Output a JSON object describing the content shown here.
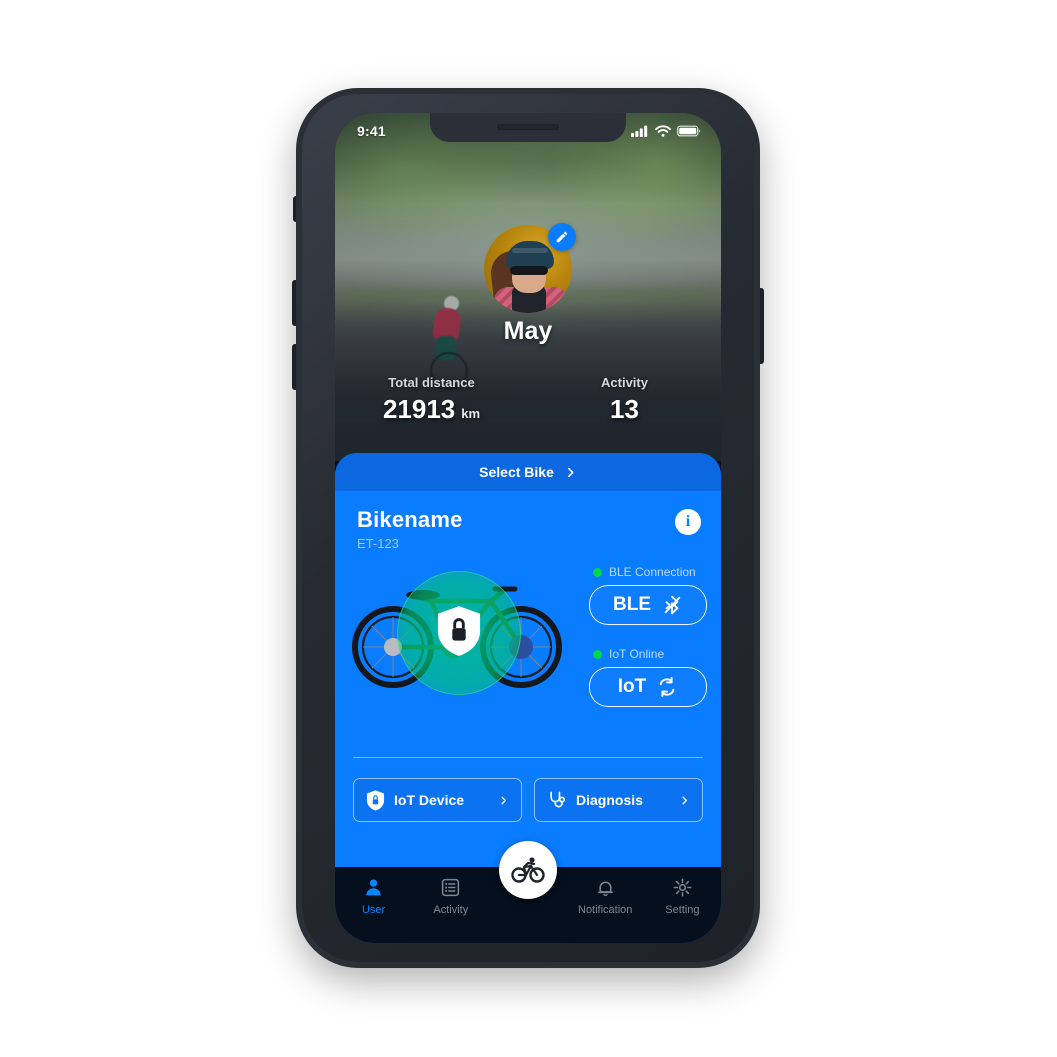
{
  "status_bar": {
    "time": "9:41",
    "icons": [
      "cellular-signal-icon",
      "wifi-icon",
      "battery-icon"
    ]
  },
  "hero": {
    "avatar_alt": "cyclist-profile-photo",
    "edit_icon": "pencil-icon",
    "profile_name": "May",
    "stats": [
      {
        "label": "Total distance",
        "value": "21913",
        "unit": "km"
      },
      {
        "label": "Activity",
        "value": "13",
        "unit": ""
      }
    ]
  },
  "card": {
    "select_bike_label": "Select Bike",
    "select_bike_icon": "chevron-right-icon",
    "bike_name": "Bikename",
    "bike_model": "ET-123",
    "info_icon": "info-icon",
    "info_glyph": "i",
    "bike_illustration_alt": "bicycle-with-lock-shield",
    "lock_icon": "shield-lock-icon",
    "connections": [
      {
        "status_label": "BLE Connection",
        "status_color": "#00d84a",
        "button_label": "BLE",
        "button_icon": "bluetooth-off-icon"
      },
      {
        "status_label": "IoT Online",
        "status_color": "#00d84a",
        "button_label": "IoT",
        "button_icon": "sync-icon"
      }
    ],
    "actions": [
      {
        "label": "IoT Device",
        "icon": "shield-lock-icon",
        "chevron": "chevron-right-icon"
      },
      {
        "label": "Diagnosis",
        "icon": "stethoscope-icon",
        "chevron": "chevron-right-icon"
      }
    ]
  },
  "tabbar": {
    "fab_icon": "cyclist-icon",
    "tabs": [
      {
        "label": "User",
        "icon": "user-icon",
        "active": true
      },
      {
        "label": "Activity",
        "icon": "list-icon",
        "active": false
      },
      {
        "label": "Notification",
        "icon": "bell-icon",
        "active": false
      },
      {
        "label": "Setting",
        "icon": "gear-icon",
        "active": false
      }
    ]
  },
  "colors": {
    "accent_blue": "#0a7cff",
    "header_blue": "#0b68e0",
    "status_green": "#00d84a",
    "tabbar_dark": "#050f1d",
    "tab_active": "#0a84ff",
    "tab_inactive": "#7b8794"
  }
}
